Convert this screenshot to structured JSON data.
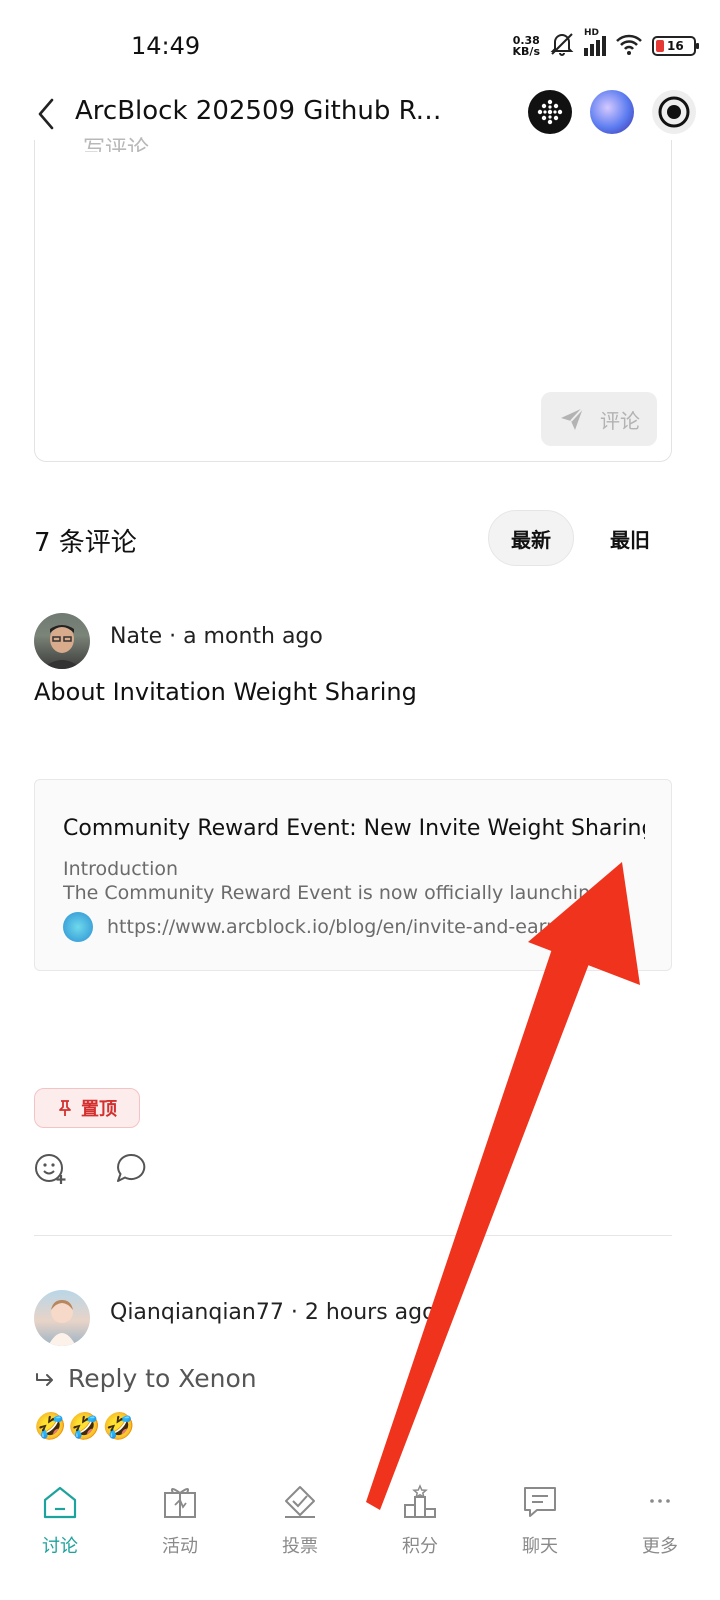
{
  "status_bar": {
    "time": "14:49",
    "net_speed_value": "0.38",
    "net_speed_unit": "KB/s",
    "signal_label": "HD",
    "battery": "16"
  },
  "header": {
    "title": "ArcBlock 202509 Github Re…"
  },
  "editor": {
    "placeholder": "写评论",
    "submit_label": "评论"
  },
  "comments": {
    "count_label": "7 条评论",
    "sort_options": [
      "最新",
      "最旧"
    ]
  },
  "comment_1": {
    "meta": "Nate · a month ago",
    "text": "About Invitation Weight Sharing",
    "card": {
      "title": "Community Reward Event: New Invite Weight Sharing",
      "subtitle": "Introduction",
      "description": "The Community Reward Event is now officially launching...",
      "url": "https://www.arcblock.io/blog/en/invite-and-earn..."
    },
    "pin_label": "置顶"
  },
  "comment_2": {
    "meta": "Qianqianqian77 · 2 hours ago",
    "reply_to": "Reply to Xenon",
    "emojis": "🤣🤣🤣"
  },
  "bottom_nav": {
    "items": [
      {
        "label": "讨论",
        "icon": "home-icon"
      },
      {
        "label": "活动",
        "icon": "gift-icon"
      },
      {
        "label": "投票",
        "icon": "vote-icon"
      },
      {
        "label": "积分",
        "icon": "leaderboard-icon"
      },
      {
        "label": "聊天",
        "icon": "chat-icon"
      },
      {
        "label": "更多",
        "icon": "more-icon"
      }
    ]
  },
  "colors": {
    "accent": "#1ba39c",
    "pin_red": "#d32f2f",
    "annotation_arrow": "#f0331c"
  }
}
